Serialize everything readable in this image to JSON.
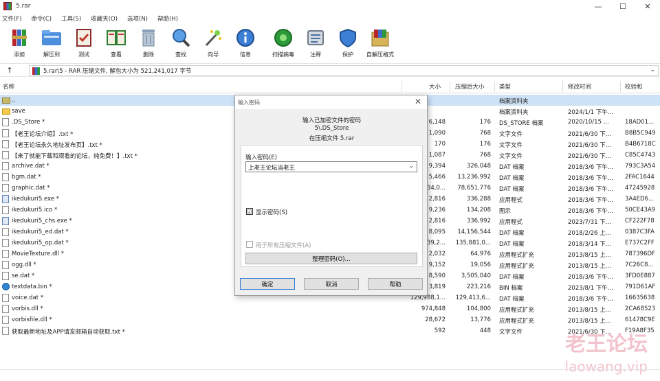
{
  "window": {
    "title": "5.rar",
    "minimize": "—",
    "maximize": "☐",
    "close": "✕"
  },
  "menu": [
    "文件(F)",
    "命令(C)",
    "工具(S)",
    "收藏夹(O)",
    "选项(N)",
    "帮助(H)"
  ],
  "toolbar": [
    {
      "label": "添加",
      "icon": "add-archive-icon"
    },
    {
      "label": "解压到",
      "icon": "extract-to-icon"
    },
    {
      "label": "测试",
      "icon": "test-icon"
    },
    {
      "label": "查看",
      "icon": "view-icon"
    },
    {
      "label": "删除",
      "icon": "delete-icon"
    },
    {
      "label": "查找",
      "icon": "find-icon"
    },
    {
      "label": "向导",
      "icon": "wizard-icon"
    },
    {
      "label": "信息",
      "icon": "info-icon"
    },
    {
      "label": "扫描病毒",
      "icon": "virus-scan-icon"
    },
    {
      "label": "注释",
      "icon": "comment-icon"
    },
    {
      "label": "保护",
      "icon": "protect-icon"
    },
    {
      "label": "自解压格式",
      "icon": "sfx-icon"
    }
  ],
  "address": {
    "path": "5.rar\\5 - RAR 压缩文件, 解包大小为 521,241,017 字节",
    "up": "↑"
  },
  "columns": {
    "name": "名称",
    "size": "大小",
    "packed": "压缩后大小",
    "type": "类型",
    "modified": "修改时间",
    "crc": "校验和"
  },
  "files": [
    {
      "name": "..",
      "size": "",
      "packed": "",
      "type": "档案资料夹",
      "modified": "",
      "crc": "",
      "icon": "up"
    },
    {
      "name": "save",
      "size": "",
      "packed": "",
      "type": "档案资料夹",
      "modified": "2024/1/1 下午...",
      "crc": "",
      "icon": "folder"
    },
    {
      "name": ".DS_Store *",
      "size": "6,148",
      "packed": "176",
      "type": "DS_STORE 档案",
      "modified": "2020/10/15 ...",
      "crc": "18AD01...",
      "icon": "doc"
    },
    {
      "name": "【老王论坛介绍】.txt *",
      "size": "1,090",
      "packed": "768",
      "type": "文字文件",
      "modified": "2021/6/30 下...",
      "crc": "B8B5C949",
      "icon": "doc"
    },
    {
      "name": "【老王论坛永久地址发布页】.txt *",
      "size": "170",
      "packed": "176",
      "type": "文字文件",
      "modified": "2021/6/30 下...",
      "crc": "B4B6718C",
      "icon": "doc"
    },
    {
      "name": "【来了就能下载和观看的论坛，纯免费！】.txt *",
      "size": "1,087",
      "packed": "768",
      "type": "文字文件",
      "modified": "2021/6/30 下...",
      "crc": "C85C4743",
      "icon": "doc"
    },
    {
      "name": "archive.dat *",
      "size": "9,394",
      "packed": "326,048",
      "type": "DAT 档案",
      "modified": "2018/3/6 下午...",
      "crc": "793C3A54",
      "icon": "doc"
    },
    {
      "name": "bgm.dat *",
      "size": "5,466",
      "packed": "13,236,992",
      "type": "DAT 档案",
      "modified": "2018/3/6 下午...",
      "crc": "2FAC1644",
      "icon": "doc"
    },
    {
      "name": "graphic.dat *",
      "size": "34,0...",
      "packed": "78,651,776",
      "type": "DAT 档案",
      "modified": "2018/3/6 下午...",
      "crc": "47245928",
      "icon": "doc"
    },
    {
      "name": "ikedukuri5.exe *",
      "size": "2,816",
      "packed": "336,288",
      "type": "应用程式",
      "modified": "2018/3/6 下午...",
      "crc": "3A4ED6...",
      "icon": "app"
    },
    {
      "name": "ikedukuri5.ico *",
      "size": "9,236",
      "packed": "134,208",
      "type": "图示",
      "modified": "2018/3/6 下午...",
      "crc": "50CE43A9",
      "icon": "doc"
    },
    {
      "name": "ikedukuri5_chs.exe *",
      "size": "2,816",
      "packed": "336,992",
      "type": "应用程式",
      "modified": "2023/7/31 下...",
      "crc": "CF222F78",
      "icon": "app"
    },
    {
      "name": "ikedukuri5_ed.dat *",
      "size": "8,095",
      "packed": "14,156,544",
      "type": "DAT 档案",
      "modified": "2018/2/26 上...",
      "crc": "0387C3FA",
      "icon": "doc"
    },
    {
      "name": "ikedukuri5_op.dat *",
      "size": "39,2...",
      "packed": "135,881,0...",
      "type": "DAT 档案",
      "modified": "2018/3/14 下...",
      "crc": "E737C2FF",
      "icon": "doc"
    },
    {
      "name": "MovieTexture.dll *",
      "size": "2,032",
      "packed": "64,976",
      "type": "应用程式扩充",
      "modified": "2013/8/15 上...",
      "crc": "787396DF",
      "icon": "doc"
    },
    {
      "name": "ogg.dll *",
      "size": "9,152",
      "packed": "19,056",
      "type": "应用程式扩充",
      "modified": "2013/8/15 上...",
      "crc": "7C26C8...",
      "icon": "doc"
    },
    {
      "name": "se.dat *",
      "size": "8,590",
      "packed": "3,505,040",
      "type": "DAT 档案",
      "modified": "2018/3/6 下午...",
      "crc": "3FD0E887",
      "icon": "doc"
    },
    {
      "name": "textdata.bin *",
      "size": "3,819",
      "packed": "223,216",
      "type": "BIN 档案",
      "modified": "2023/8/1 下午...",
      "crc": "791D61AF",
      "icon": "bin"
    },
    {
      "name": "voice.dat *",
      "size": "129,988,1...",
      "packed": "129,413,6...",
      "type": "DAT 档案",
      "modified": "2018/3/6 下午...",
      "crc": "16635638",
      "icon": "doc"
    },
    {
      "name": "vorbis.dll *",
      "size": "974,848",
      "packed": "104,800",
      "type": "应用程式扩充",
      "modified": "2013/8/15 上...",
      "crc": "2CA68523",
      "icon": "doc"
    },
    {
      "name": "vorbisfile.dll *",
      "size": "28,672",
      "packed": "13,776",
      "type": "应用程式扩充",
      "modified": "2013/8/15 上...",
      "crc": "61478C9E",
      "icon": "doc"
    },
    {
      "name": "获取最新地址及APP请发邮箱自动获取.txt *",
      "size": "592",
      "packed": "448",
      "type": "文字文件",
      "modified": "2021/6/30 下...",
      "crc": "F19A8F35",
      "icon": "doc"
    }
  ],
  "dialog": {
    "title": "输入密码",
    "close": "✕",
    "line1": "输入已加密文件的密码",
    "line2": "5\\.DS_Store",
    "line3": "在压缩文件 5.rar",
    "password_label": "输入密码(E)",
    "password_value": "上老王论坛当老王",
    "show_password_check": "☑",
    "show_password_label": "显示密码(S)",
    "use_all_label": "用于所有压缩文件(A)",
    "organize_button": "整理密码(O)...",
    "ok_button": "确定",
    "cancel_button": "取消",
    "help_button": "帮助"
  },
  "watermark": {
    "line1": "老王论坛",
    "line2": "laowang.vip"
  },
  "colors": {
    "selection": "#cde2f7",
    "accent": "#2f7bd6"
  }
}
